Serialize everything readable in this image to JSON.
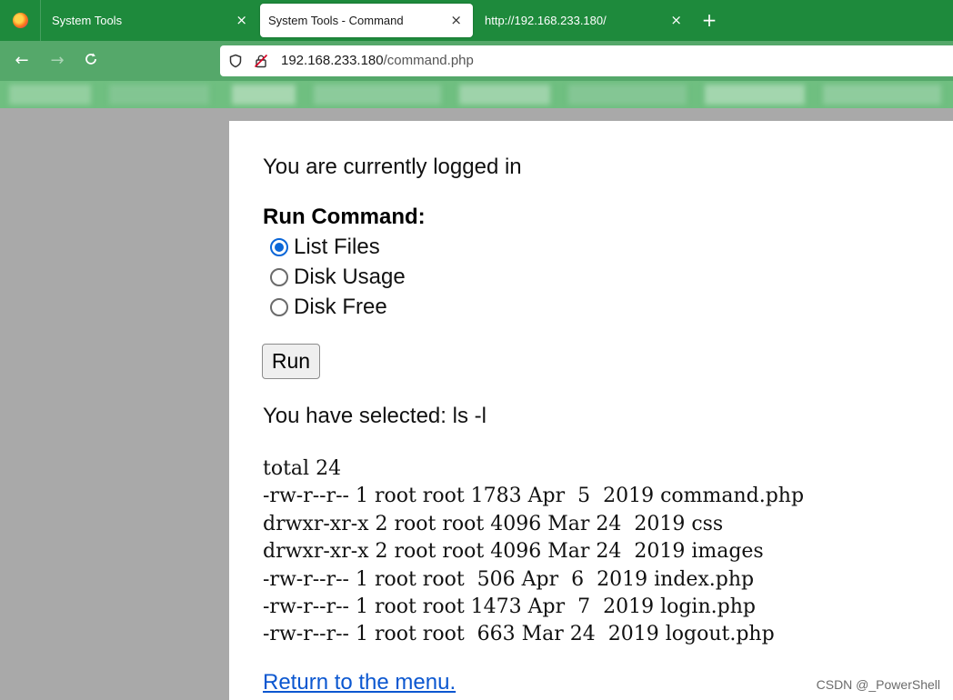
{
  "browser": {
    "tabs": [
      {
        "label": "System Tools",
        "close": "×"
      },
      {
        "label": "System Tools - Command",
        "close": "×",
        "active": true
      },
      {
        "label": "http://192.168.233.180/",
        "close": "×"
      }
    ],
    "new_tab": "+",
    "nav": {
      "back": "←",
      "forward": "→",
      "reload": "C"
    },
    "url": {
      "host": "192.168.233.180",
      "path": "/command.php"
    },
    "theme_colors": {
      "tabstrip": "#1e8a3c",
      "navbar": "#55a86a",
      "bookmarks": "#6fbf80"
    }
  },
  "page": {
    "status_text": "You are currently logged in",
    "run_heading": "Run Command:",
    "options": [
      {
        "label": "List Files",
        "checked": true
      },
      {
        "label": "Disk Usage",
        "checked": false
      },
      {
        "label": "Disk Free",
        "checked": false
      }
    ],
    "run_button": "Run",
    "selected_text": "You have selected: ls -l",
    "output_lines": [
      "total 24",
      "-rw-r--r-- 1 root root 1783 Apr  5  2019 command.php",
      "drwxr-xr-x 2 root root 4096 Mar 24  2019 css",
      "drwxr-xr-x 2 root root 4096 Mar 24  2019 images",
      "-rw-r--r-- 1 root root  506 Apr  6  2019 index.php",
      "-rw-r--r-- 1 root root 1473 Apr  7  2019 login.php",
      "-rw-r--r-- 1 root root  663 Mar 24  2019 logout.php"
    ],
    "return_link": "Return to the menu.",
    "link_color": "#0b57d0",
    "radio_accent": "#0a66d8"
  },
  "watermark": "CSDN @_PowerShell"
}
